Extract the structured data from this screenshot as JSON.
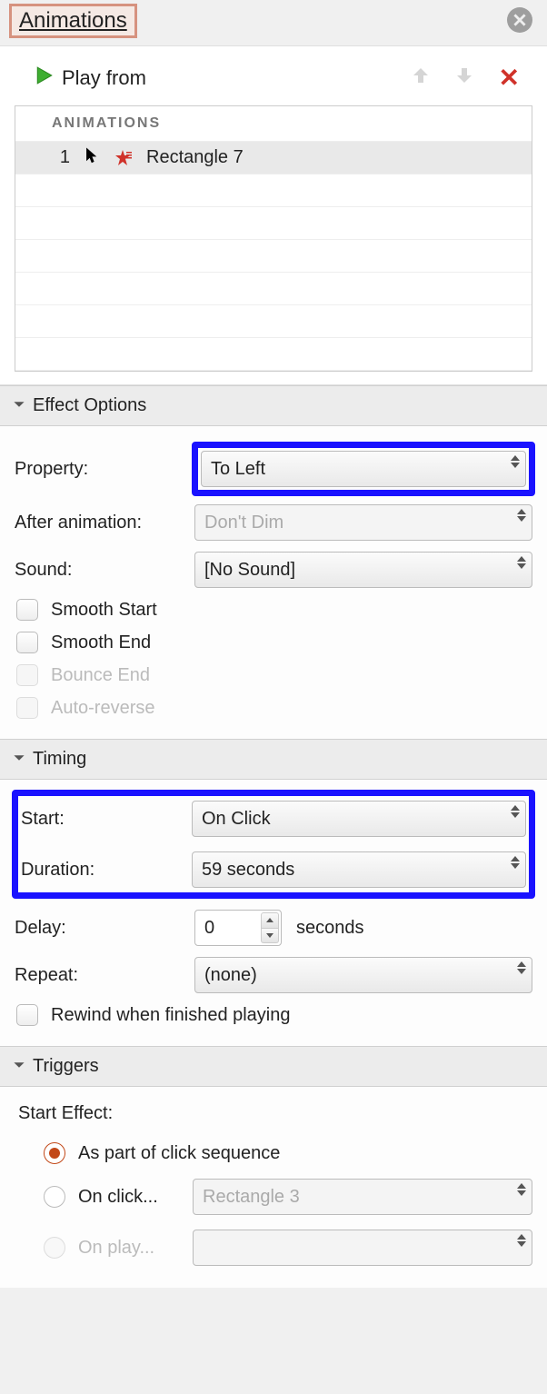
{
  "panel_title": "Animations",
  "play_from_label": "Play from",
  "list": {
    "header": "ANIMATIONS",
    "items": [
      {
        "index": "1",
        "name": "Rectangle 7"
      }
    ]
  },
  "sections": {
    "effect_options": {
      "title": "Effect Options",
      "property_label": "Property:",
      "property_value": "To Left",
      "after_animation_label": "After animation:",
      "after_animation_value": "Don't Dim",
      "sound_label": "Sound:",
      "sound_value": "[No Sound]",
      "smooth_start": "Smooth Start",
      "smooth_end": "Smooth End",
      "bounce_end": "Bounce End",
      "auto_reverse": "Auto-reverse"
    },
    "timing": {
      "title": "Timing",
      "start_label": "Start:",
      "start_value": "On Click",
      "duration_label": "Duration:",
      "duration_value": "59 seconds",
      "delay_label": "Delay:",
      "delay_value": "0",
      "delay_unit": "seconds",
      "repeat_label": "Repeat:",
      "repeat_value": "(none)",
      "rewind": "Rewind when finished playing"
    },
    "triggers": {
      "title": "Triggers",
      "start_effect": "Start Effect:",
      "opt_sequence": "As part of click sequence",
      "opt_onclick": "On click...",
      "opt_onclick_value": "Rectangle 3",
      "opt_onplay": "On play..."
    }
  }
}
